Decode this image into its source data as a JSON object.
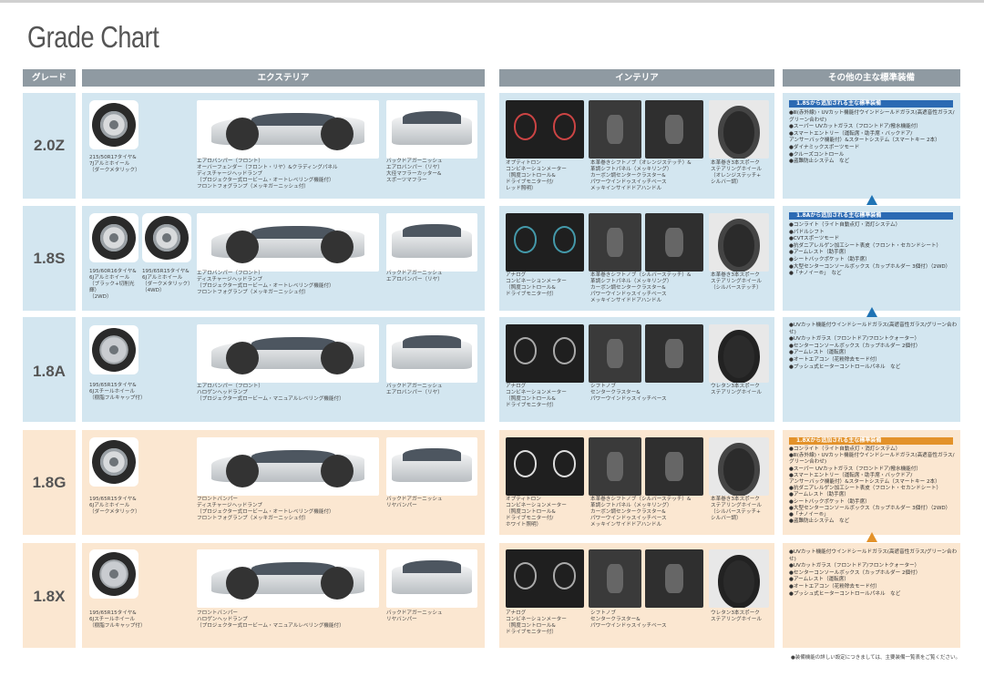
{
  "page_title": "Grade Chart",
  "headers": {
    "grade": "グレード",
    "exterior": "エクステリア",
    "interior": "インテリア",
    "other": "その他の主な標準装備"
  },
  "rows": [
    {
      "grade": "2.0Z",
      "wheel_caps": [
        "215/50R17タイヤ&\n7Jアルミホイール\n（ダークメタリック）"
      ],
      "ext_cap1": "エアロバンパー（フロント）\nオーバーフェンダー（フロント・リヤ）&クラディングパネル\nディスチャージヘッドランプ\n（プロジェクター式ロービーム・オートレベリング機能付）\nフロントフォグランプ（メッキガーニッシュ付）",
      "ext_cap2": "バックドアガーニッシュ\nエアロバンパー（リヤ）\n大径マフラーカッター&\nスポーツマフラー",
      "int_cap1": "オプティトロン\nコンビネーションメーター\n（照度コントロール&\nドライブモニター付/\nレッド照明）",
      "int_cap2": "本革巻きシフトノブ（オレンジステッチ）&\n革調シフトパネル（メッキリング）\nカーボン調センタークラスター&\nパワーウインドゥスイッチベース\nメッキインサイドドアハンドル",
      "int_cap3": "本革巻き3本スポーク\nステアリングホイール\n（オレンジステッチ+\nシルバー調）",
      "other_bar": "1.8Sから追加される主な標準装備",
      "other_list": "●Ⅲ(赤外線)・UVカット機能付ウインドシールドガラス(高遮音性ガラス/グリーン合わせ)\n●スーパー UVカットガラス（フロントドア/撥水機能付）\n●スマートエントリー（運転席・助手席・バックドア/\nアンサーバック機能付）&スタートシステム（スマートキー 2本）\n●ダイナミックスポーツモード\n●クルーズコントロール\n●盗難防止システム　など"
    },
    {
      "grade": "1.8S",
      "wheel_caps": [
        "195/60R16タイヤ&\n6Jアルミホイール\n（ブラック+切削光輝）\n（2WD）",
        "195/65R15タイヤ&\n6Jアルミホイール\n（ダークメタリック）\n（4WD）"
      ],
      "ext_cap1": "エアロバンパー（フロント）\nディスチャージヘッドランプ\n（プロジェクター式ロービーム・オートレベリング機能付）\nフロントフォグランプ（メッキガーニッシュ付）",
      "ext_cap2": "バックドアガーニッシュ\nエアロバンパー（リヤ）",
      "int_cap1": "アナログ\nコンビネーションメーター\n（照度コントロール&\nドライブモニター付）",
      "int_cap2": "本革巻きシフトノブ（シルバーステッチ）&\n革調シフトパネル（メッキリング）\nカーボン調センタークラスター&\nパワーウインドゥスイッチベース\nメッキインサイドドアハンドル",
      "int_cap3": "本革巻き3本スポーク\nステアリングホイール\n（シルバーステッチ）",
      "other_bar": "1.8Aから追加される主な標準装備",
      "other_list": "●コンライト（ライト自動点灯・消灯システム）\n●パドルシフト\n●CVTスポーツモード\n●抗ダニアレルゲン加工シート表皮（フロント・セカンドシート）\n●アームレスト（助手席）\n●シートバックポケット（助手席）\n●大型センターコンソールボックス（カップホルダー 3個付）（2WD）\n●「ナノイー®」　など"
    },
    {
      "grade": "1.8A",
      "wheel_caps": [
        "195/65R15タイヤ&\n6Jスチールホイール\n（樹脂フルキャップ付）"
      ],
      "ext_cap1": "エアロバンパー（フロント）\nハロゲンヘッドランプ\n（プロジェクター式ロービーム・マニュアルレベリング機能付）",
      "ext_cap2": "バックドアガーニッシュ\nエアロバンパー（リヤ）",
      "int_cap1": "アナログ\nコンビネーションメーター\n（照度コントロール&\nドライブモニター付）",
      "int_cap2": "シフトノブ\nセンタークラスター&\nパワーウインドゥスイッチベース",
      "int_cap3": "ウレタン3本スポーク\nステアリングホイール",
      "other_bar": "",
      "other_list": "●UVカット機能付ウインドシールドガラス(高遮音性ガラス/グリーン合わせ)\n●UVカットガラス（フロントドア/フロントクォーター）\n●センターコンソールボックス（カップホルダー 2個付）\n●アームレスト（運転席）\n●オートエアコン（花粉除去モード付）\n●プッシュ式ヒーターコントロールパネル　など"
    },
    {
      "grade": "1.8G",
      "wheel_caps": [
        "195/65R15タイヤ&\n6Jアルミホイール\n（ダークメタリック）"
      ],
      "ext_cap1": "フロントバンパー\nディスチャージヘッドランプ\n（プロジェクター式ロービーム・オートレベリング機能付）\nフロントフォグランプ（メッキガーニッシュ付）",
      "ext_cap2": "バックドアガーニッシュ\nリヤバンパー",
      "int_cap1": "オプティトロン\nコンビネーションメーター\n（照度コントロール&\nドライブモニター付/\nホワイト照明）",
      "int_cap2": "本革巻きシフトノブ（シルバーステッチ）&\n革調シフトパネル（メッキリング）\nカーボン調センタークラスター&\nパワーウインドゥスイッチベース\nメッキインサイドドアハンドル",
      "int_cap3": "本革巻き3本スポーク\nステアリングホイール\n（シルバーステッチ+\nシルバー調）",
      "other_bar": "1.8Xから追加される主な標準装備",
      "other_list": "●コンライト（ライト自動点灯・消灯システム）\n●Ⅲ(赤外線)・UVカット機能付ウインドシールドガラス(高遮音性ガラス/グリーン合わせ)\n●スーパー UVカットガラス（フロントドア/撥水機能付）\n●スマートエントリー（運転席・助手席・バックドア/\nアンサーバック機能付）&スタートシステム（スマートキー 2本）\n●抗ダニアレルゲン加工シート表皮（フロント・セカンドシート）\n●アームレスト（助手席）\n●シートバックポケット（助手席）\n●大型センターコンソールボックス（カップホルダー 3個付）（2WD）\n●「ナノイー®」\n●盗難防止システム　など"
    },
    {
      "grade": "1.8X",
      "wheel_caps": [
        "195/65R15タイヤ&\n6Jスチールホイール\n（樹脂フルキャップ付）"
      ],
      "ext_cap1": "フロントバンパー\nハロゲンヘッドランプ\n（プロジェクター式ロービーム・マニュアルレベリング機能付）",
      "ext_cap2": "バックドアガーニッシュ\nリヤバンパー",
      "int_cap1": "アナログ\nコンビネーションメーター\n（照度コントロール&\nドライブモニター付）",
      "int_cap2": "シフトノブ\nセンタークラスター&\nパワーウインドゥスイッチベース",
      "int_cap3": "ウレタン3本スポーク\nステアリングホイール",
      "other_bar": "",
      "other_list": "●UVカット機能付ウインドシールドガラス(高遮音性ガラス/グリーン合わせ)\n●UVカットガラス（フロントドア/フロントクォーター）\n●センターコンソールボックス（カップホルダー 2個付）\n●アームレスト（運転席）\n●オートエアコン（花粉除去モード付）\n●プッシュ式ヒーターコントロールパネル　など"
    }
  ],
  "footer": "●装備機能の詳しい設定につきましては、主要装備一覧表をご覧ください。",
  "colors": {
    "blue_panel": "#d3e6f0",
    "orange_panel": "#fbe7d1",
    "header": "#8f9aa2",
    "blue_bar": "#2b6ab3",
    "orange_bar": "#e3922a"
  }
}
